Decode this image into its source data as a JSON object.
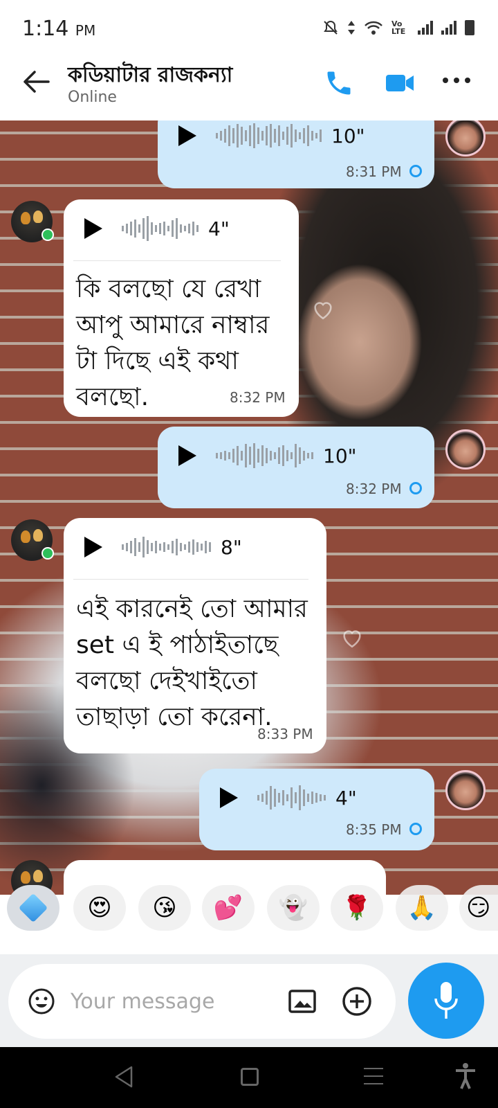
{
  "status_bar": {
    "time": "1:14",
    "ampm": "PM",
    "network_label": "Vo LTE"
  },
  "header": {
    "contact_name": "কডিয়াটার রাজকন্যা",
    "contact_status": "Online"
  },
  "messages": [
    {
      "direction": "out",
      "type": "voice",
      "duration": "10\"",
      "time": "8:31 PM"
    },
    {
      "direction": "in",
      "type": "voice+text",
      "duration": "4\"",
      "text_lines": [
        "কি বলছো যে রেখা",
        "আপু আমারে নাম্বার",
        "টা দিছে এই কথা",
        "বলছো."
      ],
      "time": "8:32 PM"
    },
    {
      "direction": "out",
      "type": "voice",
      "duration": "10\"",
      "time": "8:32 PM"
    },
    {
      "direction": "in",
      "type": "voice+text",
      "duration": "8\"",
      "text_lines": [
        "এই কারনেই তো আমার",
        "set এ ই পাঠাইতাছে",
        "বলছো দেইখাইতো",
        "তাছাড়া তো করেনা."
      ],
      "time": "8:33 PM"
    },
    {
      "direction": "out",
      "type": "voice",
      "duration": "4\"",
      "time": "8:35 PM"
    }
  ],
  "emoji_strip": [
    "cube-sticker",
    "😍",
    "😘",
    "💕",
    "👻",
    "🌹",
    "🙏",
    "😏"
  ],
  "composer": {
    "placeholder": "Your message"
  },
  "colors": {
    "accent": "#1e9bf0",
    "outgoing_bubble": "#cfe9fb",
    "incoming_bubble": "#ffffff"
  }
}
